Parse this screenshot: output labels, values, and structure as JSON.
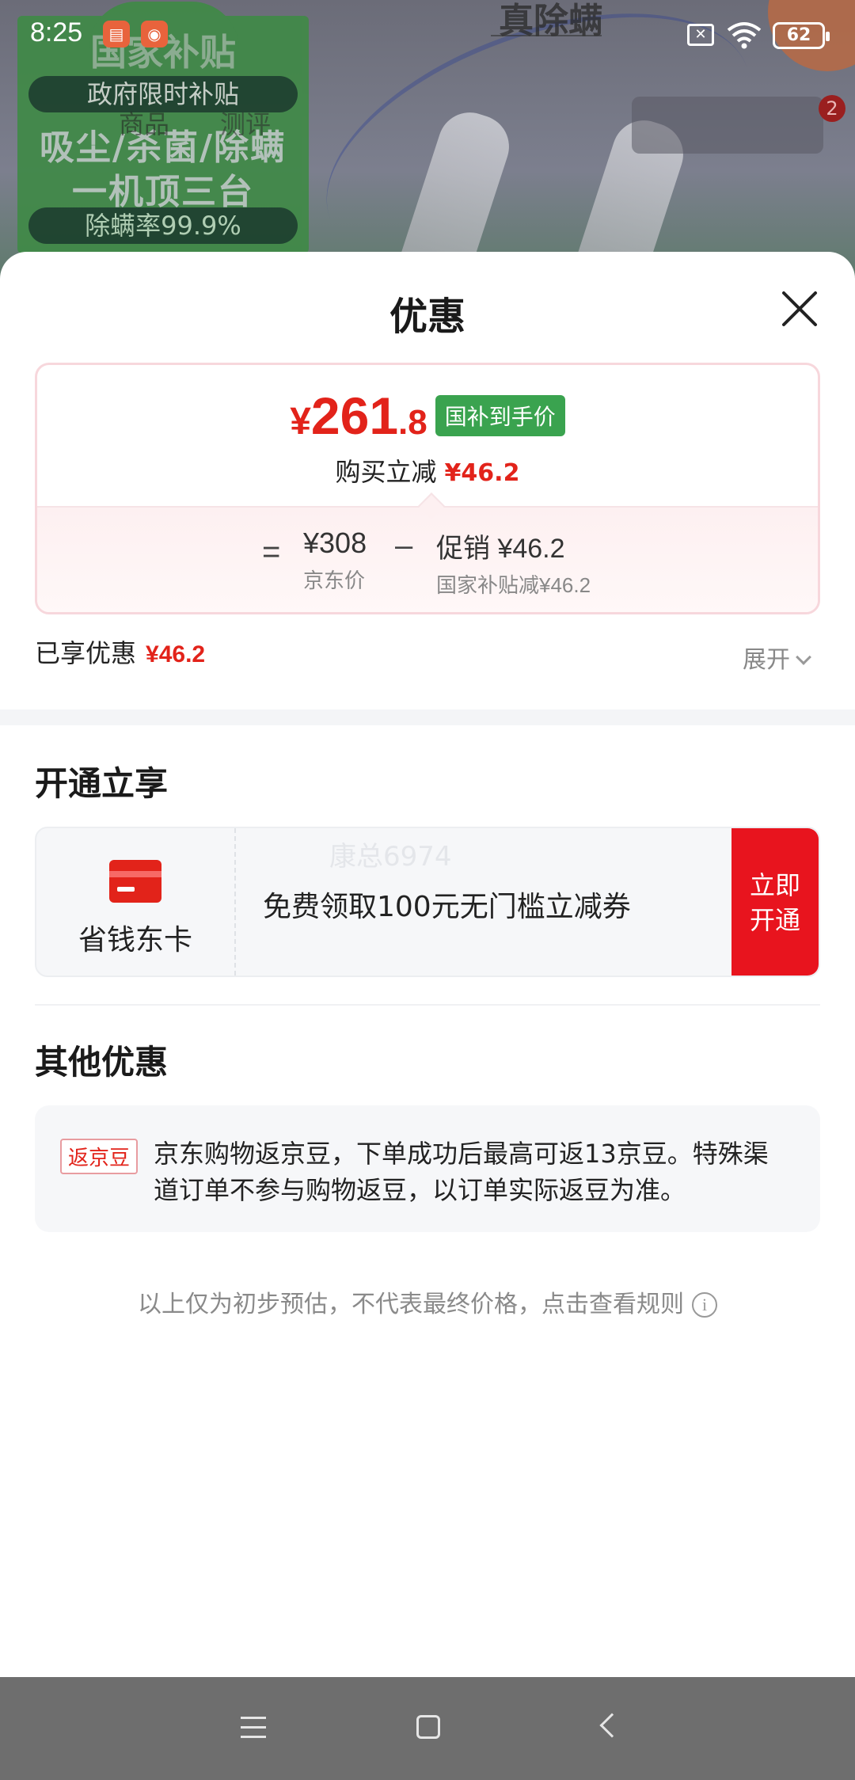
{
  "status_bar": {
    "time": "8:25",
    "battery": "62"
  },
  "background": {
    "promo_header": "国家补贴",
    "promo_pill_top": "政府限时补贴",
    "promo_line_1": "吸尘/杀菌/除螨",
    "promo_line_2": "一机顶三台",
    "promo_pill_bottom": "除螨率99.9%",
    "brand_text": "真除螨",
    "tabs": [
      "商品",
      "测评"
    ],
    "cart_badge": "2"
  },
  "sheet": {
    "title": "优惠"
  },
  "price_card": {
    "currency": "¥",
    "price_int": "261",
    "price_dec": ".8",
    "price_tag": "国补到手价",
    "reduce_label": "购买立减",
    "reduce_amount": "¥46.2",
    "eq_symbol": "=",
    "jd_price": "¥308",
    "jd_price_label": "京东价",
    "minus_symbol": "–",
    "promo_label": "促销 ¥46.2",
    "promo_sub": "国家补贴减¥46.2"
  },
  "enjoyed": {
    "label": "已享优惠",
    "amount": "¥46.2",
    "expand_label": "展开"
  },
  "open_section": {
    "title": "开通立享",
    "card_name": "省钱东卡",
    "description": "免费领取100元无门槛立减券",
    "watermark": "康总6974",
    "button_label_line1": "立即",
    "button_label_line2": "开通"
  },
  "other_section": {
    "title": "其他优惠",
    "tag": "返京豆",
    "text": "京东购物返京豆，下单成功后最高可返13京豆。特殊渠道订单不参与购物返豆，以订单实际返豆为准。"
  },
  "disclaimer": "以上仅为初步预估，不代表最终价格，点击查看规则",
  "colors": {
    "accent_red": "#e2231a",
    "tag_green": "#3aa34f"
  }
}
